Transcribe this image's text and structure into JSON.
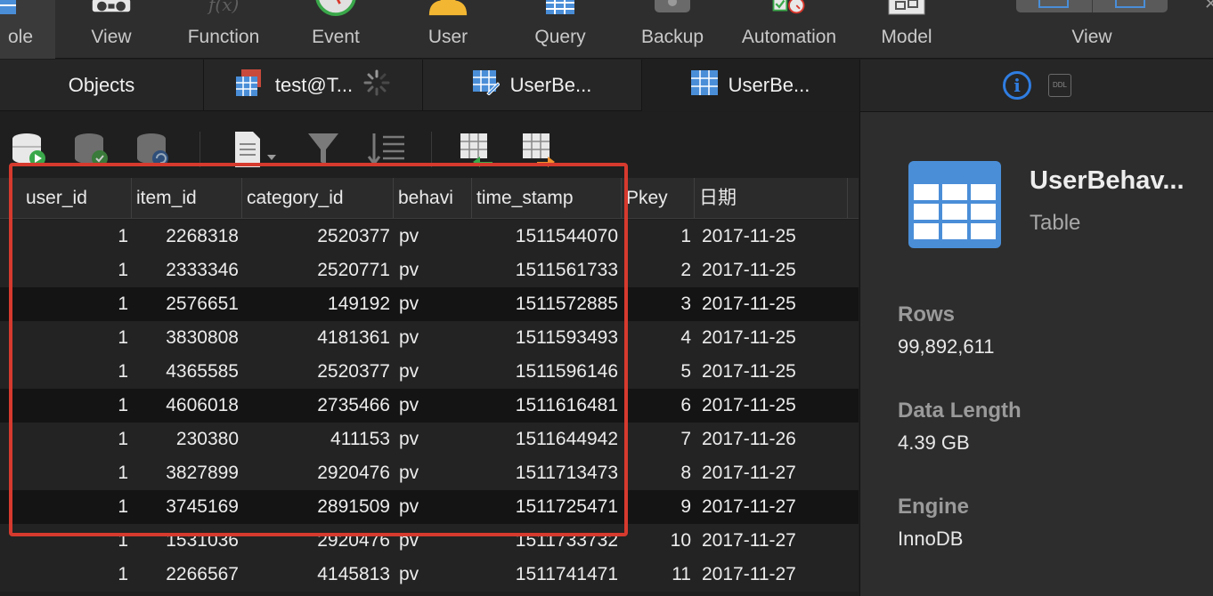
{
  "toolbar": {
    "items": [
      {
        "label": "ole",
        "icon": "table-icon",
        "active": true
      },
      {
        "label": "View",
        "icon": "view-icon"
      },
      {
        "label": "Function",
        "icon": "function-icon"
      },
      {
        "label": "Event",
        "icon": "event-icon"
      },
      {
        "label": "User",
        "icon": "user-icon"
      },
      {
        "label": "Query",
        "icon": "query-icon"
      },
      {
        "label": "Backup",
        "icon": "backup-icon"
      },
      {
        "label": "Automation",
        "icon": "automation-icon"
      },
      {
        "label": "Model",
        "icon": "model-icon"
      }
    ],
    "view_label": "View"
  },
  "tabs": [
    {
      "label": "Objects"
    },
    {
      "label": "test@T..."
    },
    {
      "label": "UserBe..."
    },
    {
      "label": "UserBe...",
      "active": true
    }
  ],
  "grid": {
    "columns": [
      "user_id",
      "item_id",
      "category_id",
      "behavi",
      "time_stamp",
      "Pkey",
      "日期"
    ],
    "rows": [
      [
        "1",
        "2268318",
        "2520377",
        "pv",
        "1511544070",
        "1",
        "2017-11-25"
      ],
      [
        "1",
        "2333346",
        "2520771",
        "pv",
        "1511561733",
        "2",
        "2017-11-25"
      ],
      [
        "1",
        "2576651",
        "149192",
        "pv",
        "1511572885",
        "3",
        "2017-11-25"
      ],
      [
        "1",
        "3830808",
        "4181361",
        "pv",
        "1511593493",
        "4",
        "2017-11-25"
      ],
      [
        "1",
        "4365585",
        "2520377",
        "pv",
        "1511596146",
        "5",
        "2017-11-25"
      ],
      [
        "1",
        "4606018",
        "2735466",
        "pv",
        "1511616481",
        "6",
        "2017-11-25"
      ],
      [
        "1",
        "230380",
        "411153",
        "pv",
        "1511644942",
        "7",
        "2017-11-26"
      ],
      [
        "1",
        "3827899",
        "2920476",
        "pv",
        "1511713473",
        "8",
        "2017-11-27"
      ],
      [
        "1",
        "3745169",
        "2891509",
        "pv",
        "1511725471",
        "9",
        "2017-11-27"
      ],
      [
        "1",
        "1531036",
        "2920476",
        "pv",
        "1511733732",
        "10",
        "2017-11-27"
      ],
      [
        "1",
        "2266567",
        "4145813",
        "pv",
        "1511741471",
        "11",
        "2017-11-27"
      ]
    ]
  },
  "info": {
    "name": "UserBehav...",
    "type": "Table",
    "ddl_label": "DDL",
    "props": [
      {
        "key": "Rows",
        "value": "99,892,611"
      },
      {
        "key": "Data Length",
        "value": "4.39 GB"
      },
      {
        "key": "Engine",
        "value": "InnoDB"
      }
    ]
  },
  "colors": {
    "highlight": "#d63a2e",
    "accent": "#2f7de1",
    "table_icon": "#4a8ed8"
  }
}
